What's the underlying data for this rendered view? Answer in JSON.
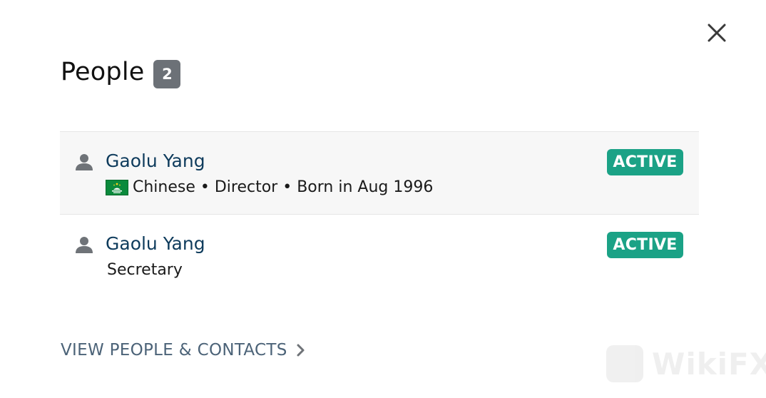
{
  "header": {
    "title": "People",
    "count": "2"
  },
  "people": [
    {
      "name": "Gaolu Yang",
      "status": "ACTIVE",
      "flag_icon": "macau-flag-icon",
      "details": "Chinese • Director • Born in Aug 1996"
    },
    {
      "name": "Gaolu Yang",
      "status": "ACTIVE",
      "details": "Secretary"
    }
  ],
  "footer": {
    "link_label": "VIEW PEOPLE & CONTACTS"
  },
  "watermark": {
    "text": "WikiFX"
  },
  "colors": {
    "name_link": "#0e3b5c",
    "status_active": "#1ba286",
    "count_badge": "#6c7177",
    "footer_link": "#4c6378",
    "row_highlight": "#f7f7f7"
  }
}
